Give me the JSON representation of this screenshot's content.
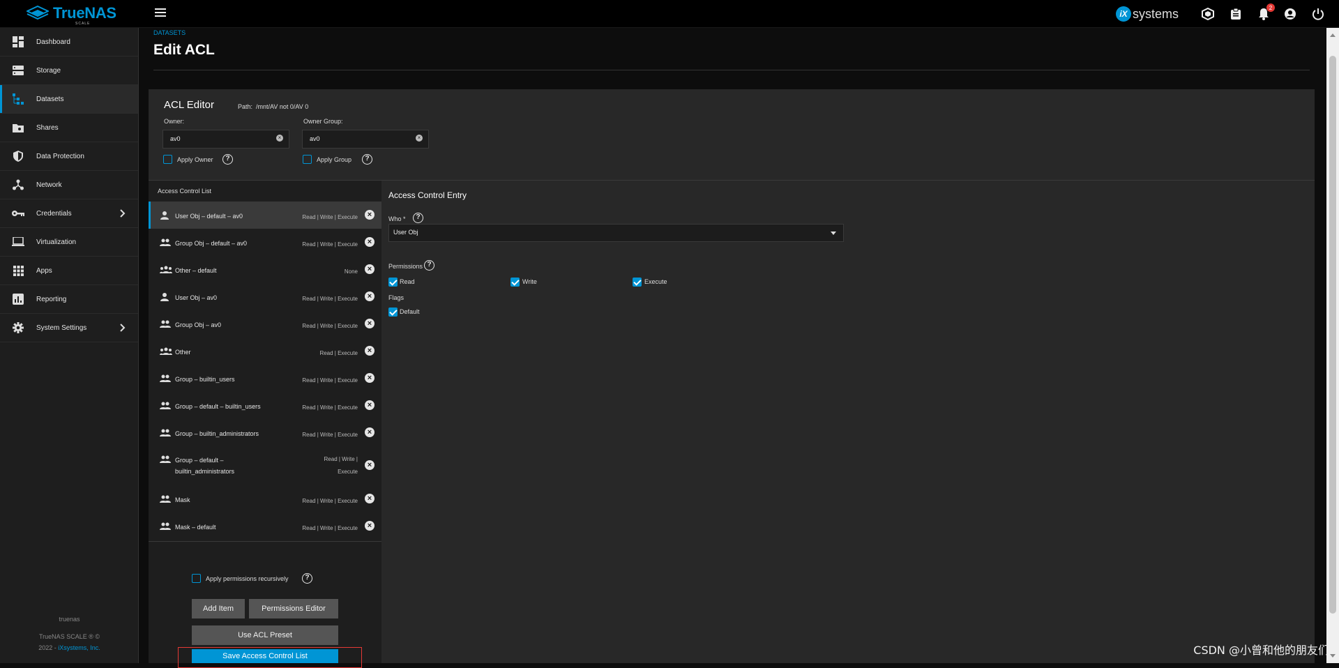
{
  "brand": {
    "name": "TrueNAS",
    "sub": "SCALE",
    "vendor": "systems",
    "vendor_mark": "iX"
  },
  "topbar": {
    "notification_count": "2"
  },
  "sidebar": {
    "items": [
      {
        "label": "Dashboard",
        "icon": "dashboard-icon"
      },
      {
        "label": "Storage",
        "icon": "storage-icon"
      },
      {
        "label": "Datasets",
        "icon": "datasets-icon"
      },
      {
        "label": "Shares",
        "icon": "shares-icon"
      },
      {
        "label": "Data Protection",
        "icon": "shield-icon"
      },
      {
        "label": "Network",
        "icon": "network-icon"
      },
      {
        "label": "Credentials",
        "icon": "key-icon"
      },
      {
        "label": "Virtualization",
        "icon": "laptop-icon"
      },
      {
        "label": "Apps",
        "icon": "apps-icon"
      },
      {
        "label": "Reporting",
        "icon": "chart-icon"
      },
      {
        "label": "System Settings",
        "icon": "gear-icon"
      }
    ],
    "footer": {
      "hostname": "truenas",
      "product": "TrueNAS SCALE ® ©",
      "year": "2022 -",
      "company": "iXsystems, Inc."
    }
  },
  "page": {
    "breadcrumb": "DATASETS",
    "title": "Edit ACL"
  },
  "editor": {
    "title": "ACL Editor",
    "path_label": "Path:",
    "path": "/mnt/AV not 0/AV 0",
    "owner_label": "Owner:",
    "owner_value": "av0",
    "group_label": "Owner Group:",
    "group_value": "av0",
    "apply_owner": "Apply Owner",
    "apply_group": "Apply Group"
  },
  "acl": {
    "heading": "Access Control List",
    "entries": [
      {
        "name": "User Obj – default – av0",
        "perm": "Read | Write | Execute",
        "icon": "user-icon"
      },
      {
        "name": "Group Obj – default – av0",
        "perm": "Read | Write | Execute",
        "icon": "group-icon"
      },
      {
        "name": "Other – default",
        "perm": "None",
        "icon": "others-icon"
      },
      {
        "name": "User Obj – av0",
        "perm": "Read | Write | Execute",
        "icon": "user-icon"
      },
      {
        "name": "Group Obj – av0",
        "perm": "Read | Write | Execute",
        "icon": "group-icon"
      },
      {
        "name": "Other",
        "perm": "Read | Execute",
        "icon": "others-icon"
      },
      {
        "name": "Group – builtin_users",
        "perm": "Read | Write | Execute",
        "icon": "group-icon"
      },
      {
        "name": "Group – default – builtin_users",
        "perm": "Read | Write | Execute",
        "icon": "group-icon"
      },
      {
        "name": "Group – builtin_administrators",
        "perm": "Read | Write | Execute",
        "icon": "group-icon"
      },
      {
        "name": "Group – default – builtin_administrators",
        "perm": "Read | Write | Execute",
        "icon": "group-icon"
      },
      {
        "name": "Mask",
        "perm": "Read | Write | Execute",
        "icon": "group-icon"
      },
      {
        "name": "Mask – default",
        "perm": "Read | Write | Execute",
        "icon": "group-icon"
      }
    ],
    "recursive_label": "Apply permissions recursively",
    "add_item": "Add Item",
    "permissions_editor": "Permissions Editor",
    "use_preset": "Use ACL Preset",
    "save": "Save Access Control List"
  },
  "ace": {
    "title": "Access Control Entry",
    "who_label": "Who *",
    "who_value": "User Obj",
    "permissions_label": "Permissions",
    "read": "Read",
    "write": "Write",
    "execute": "Execute",
    "flags_label": "Flags",
    "default": "Default"
  },
  "watermark": "CSDN @小曾和他的朋友们"
}
